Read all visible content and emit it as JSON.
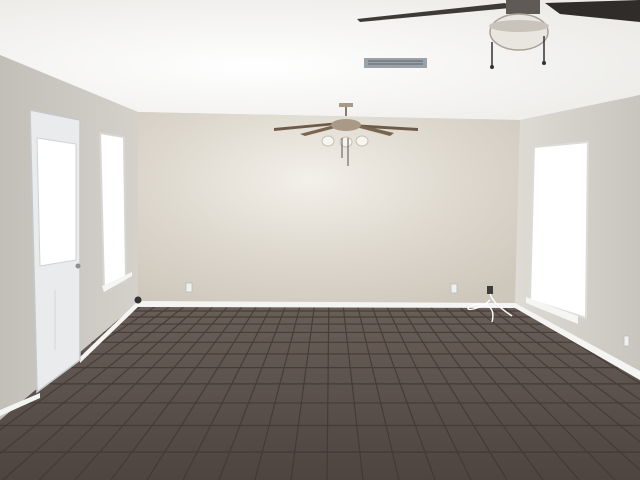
{
  "scene": {
    "subject": "empty-room",
    "colors": {
      "ceiling": "#f2f2f0",
      "back_wall": "#d8d3c8",
      "left_wall": "#c9c6bf",
      "right_wall": "#cfccc5",
      "baseboard": "#f4f4f2",
      "floor": "#5c514b",
      "floor_grout": "#3f3733",
      "window_light": "#ffffff",
      "door": "#e9ebec",
      "fan_blade": "#6e5a48",
      "fan_metal": "#a89a86"
    },
    "icons": [
      "ceiling-fan-icon",
      "door-icon",
      "window-icon",
      "air-vent-icon",
      "outlet-icon"
    ]
  }
}
